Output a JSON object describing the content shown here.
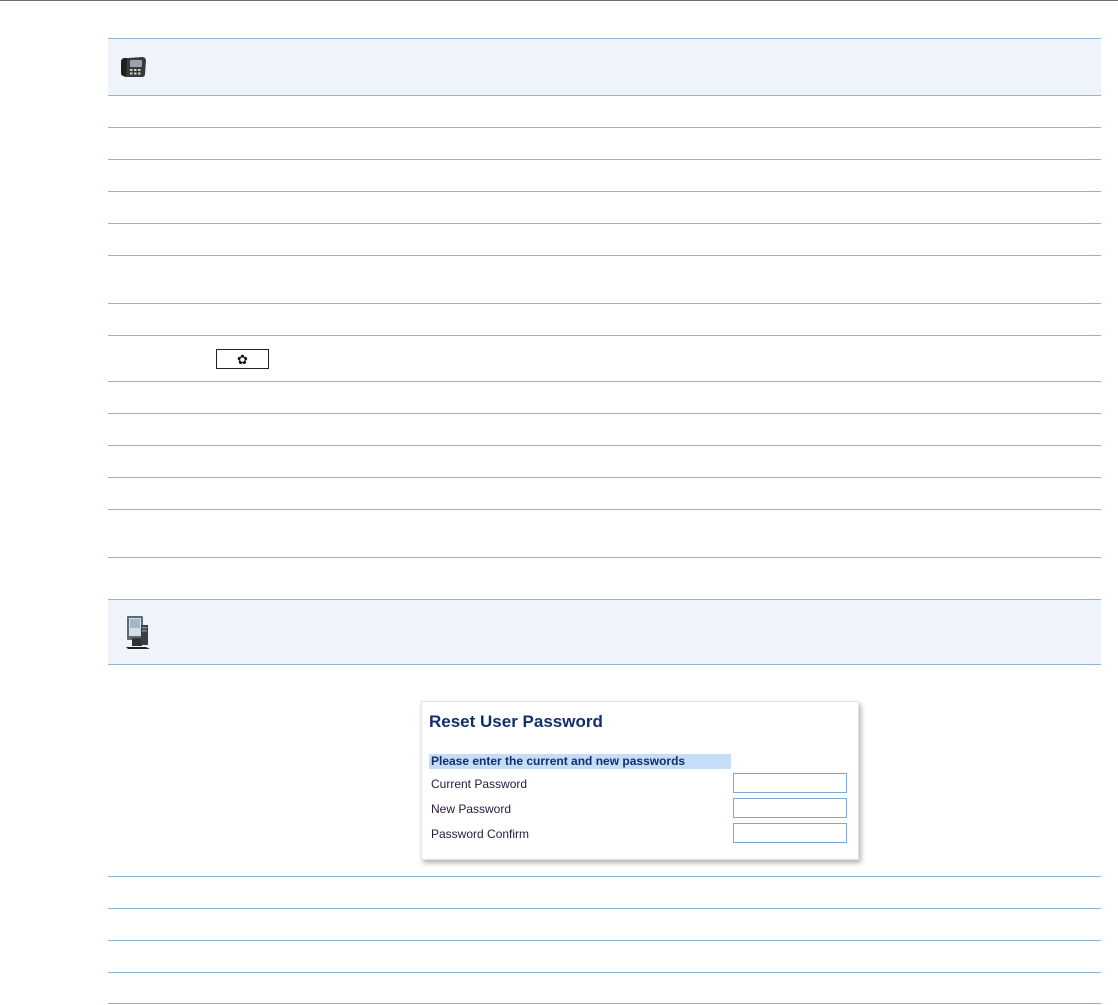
{
  "page": {
    "phone_section_icon": "desk-phone-icon",
    "web_section_icon": "computer-workstation-icon",
    "settings_key_icon": "gear-icon",
    "settings_key_glyph": "✿",
    "accent_color": "#8fb4d9",
    "band_color": "#eef4fa"
  },
  "web_ui_screenshot": {
    "title": "Reset User Password",
    "instruction": "Please enter the current and new passwords",
    "fields": [
      {
        "label": "Current Password",
        "value": ""
      },
      {
        "label": "New Password",
        "value": ""
      },
      {
        "label": "Password Confirm",
        "value": ""
      }
    ]
  }
}
